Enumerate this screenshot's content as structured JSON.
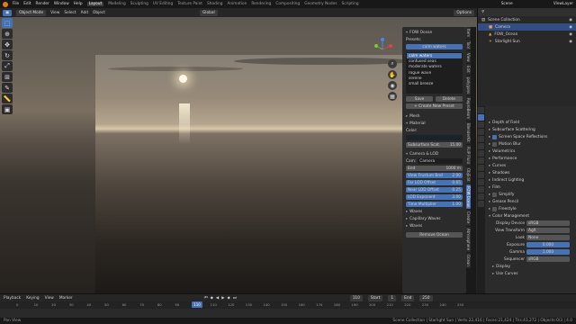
{
  "topbar": {
    "menus": [
      "File",
      "Edit",
      "Render",
      "Window",
      "Help"
    ],
    "workspaces": [
      "Layout",
      "Modeling",
      "Sculpting",
      "UV Editing",
      "Texture Paint",
      "Shading",
      "Animation",
      "Rendering",
      "Compositing",
      "Geometry Nodes",
      "Scripting"
    ],
    "active_workspace": "Layout",
    "scene": "Scene",
    "view_layer": "ViewLayer"
  },
  "viewport_header": {
    "mode": "Object Mode",
    "menus": [
      "View",
      "Select",
      "Add",
      "Object"
    ],
    "transform": "Global",
    "options": "Options"
  },
  "npanel": {
    "panel_title": "FOW Ocean",
    "presets_label": "Presets:",
    "preset_selected": "calm waters",
    "presets": [
      "calm waters",
      "confused seas",
      "moderate waters",
      "rogue wave",
      "serene",
      "small breeze"
    ],
    "save": "Save",
    "delete": "Delete",
    "create_preset": "+ Create New Preset",
    "mesh": "Mesh",
    "material": "Material",
    "color_label": "Color:",
    "subsurface_label": "Subsurface Scat.",
    "subsurface_value": "15.00",
    "camera_lod": "Camera & LOD",
    "cam_label": "Cam:",
    "camera_value": "Camera",
    "end_label": "End",
    "end_value": "1000 m",
    "lod_rows": [
      {
        "label": "View Frustum Bnd",
        "value": "2.00"
      },
      {
        "label": "Far LOD Offset",
        "value": "0.65"
      },
      {
        "label": "Near LOD Offset",
        "value": "0.25"
      },
      {
        "label": "LOD Exponent",
        "value": "3.00"
      },
      {
        "label": "Time Multiplier",
        "value": "1.00"
      }
    ],
    "waves": "Waves",
    "capillary_waves": "Capillary Waves",
    "foam": "Waves",
    "remove": "Remove Ocean"
  },
  "sidetabs": [
    "Item",
    "Tool",
    "View",
    "Edit",
    "polygons",
    "ReproBeam",
    "BlenderKit",
    "FLIP Fluid",
    "ObjEdit",
    "FOW Ocean",
    "Create",
    "Atmosphere",
    "Ocean"
  ],
  "outliner": {
    "title": "Scene Collection",
    "items": [
      {
        "name": "Scene Collection",
        "sel": false
      },
      {
        "name": "Camera",
        "sel": true
      },
      {
        "name": "FOW_Ocean",
        "sel": false
      },
      {
        "name": "Starlight Sun",
        "sel": false
      }
    ]
  },
  "properties": {
    "rows": [
      {
        "label": "Depth of Field",
        "kind": "panel"
      },
      {
        "label": "Subsurface Scattering",
        "kind": "panel"
      },
      {
        "label": "Screen Space Reflections",
        "kind": "check"
      },
      {
        "label": "Motion Blur",
        "kind": "check"
      },
      {
        "label": "Volumetrics",
        "kind": "panel"
      },
      {
        "label": "Performance",
        "kind": "panel"
      },
      {
        "label": "Curves",
        "kind": "panel"
      },
      {
        "label": "Shadows",
        "kind": "panel"
      },
      {
        "label": "Indirect Lighting",
        "kind": "panel"
      },
      {
        "label": "Film",
        "kind": "panel"
      },
      {
        "label": "Simplify",
        "kind": "check"
      },
      {
        "label": "Grease Pencil",
        "kind": "panel"
      },
      {
        "label": "Freestyle",
        "kind": "check"
      },
      {
        "label": "Color Management",
        "kind": "open"
      }
    ],
    "cm": [
      {
        "label": "Display Device",
        "value": "sRGB"
      },
      {
        "label": "View Transform",
        "value": "AgX"
      },
      {
        "label": "Look",
        "value": "None"
      },
      {
        "label": "Exposure",
        "value": "0.000"
      },
      {
        "label": "Gamma",
        "value": "1.000"
      },
      {
        "label": "Sequencer",
        "value": "sRGB"
      }
    ],
    "display": "Display",
    "use_curves": "Use Curves"
  },
  "timeline": {
    "menus": [
      "Playback",
      "Keying",
      "View",
      "Marker"
    ],
    "current_frame": "110",
    "start_label": "Start",
    "start": "1",
    "end_label": "End",
    "end": "250",
    "frame_field": "110",
    "ticks": [
      "0",
      "10",
      "20",
      "30",
      "40",
      "50",
      "60",
      "70",
      "80",
      "90",
      "100",
      "110",
      "120",
      "130",
      "140",
      "150",
      "160",
      "170",
      "180",
      "190",
      "200",
      "210",
      "220",
      "230",
      "240",
      "250"
    ]
  },
  "statusbar": {
    "left": "Pan View",
    "right": "Scene Collection | Starlight Sun | Verts:22,416 | Faces:21,424 | Tris:43,272 | Objects:0/3 | 4.0"
  }
}
